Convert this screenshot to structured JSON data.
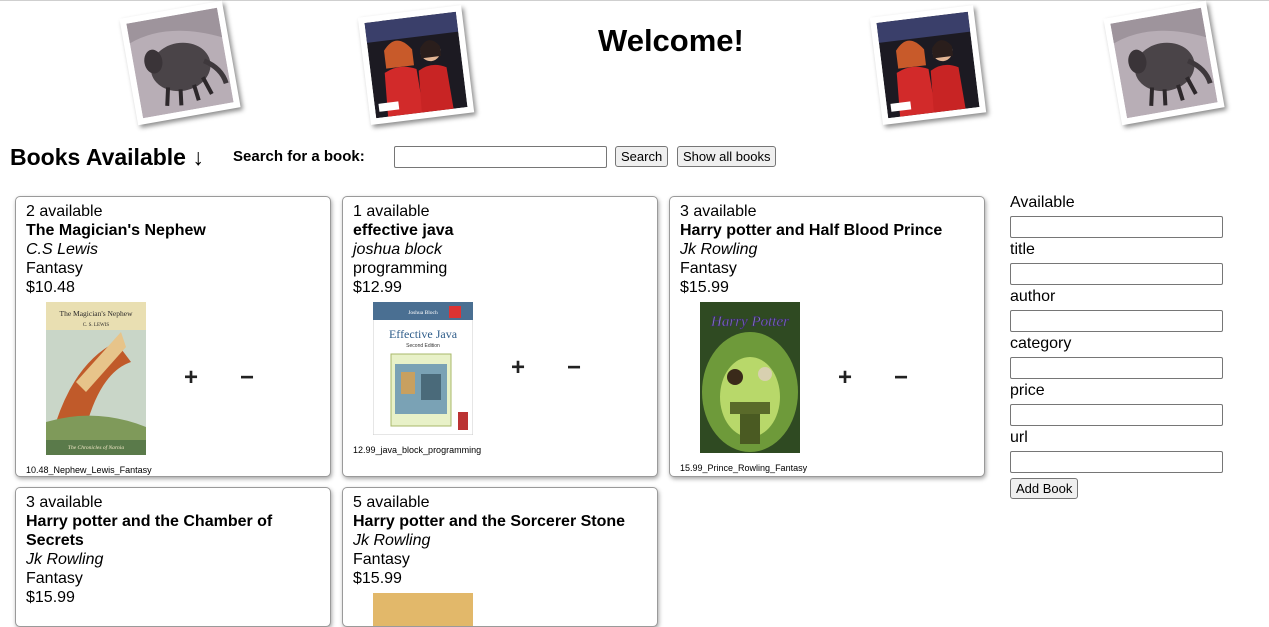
{
  "header": {
    "welcome": "Welcome!",
    "images": [
      "armadillo-photo",
      "two-women-tv-photo",
      "two-women-tv-photo",
      "armadillo-photo"
    ]
  },
  "toolbar": {
    "books_title": "Books Available ↓",
    "search_label": "Search for a book:",
    "search_value": "",
    "search_button": "Search",
    "show_all_button": "Show all books"
  },
  "books": [
    {
      "available": "2 available",
      "title": "The Magician's Nephew",
      "author": "C.S Lewis",
      "category": "Fantasy",
      "price": "$10.48",
      "caption": "10.48_Nephew_Lewis_Fantasy",
      "cover_text": [
        "The Magician's Nephew",
        "C. S. LEWIS",
        "The Chronicles of Narnia"
      ],
      "plus": "+",
      "minus": "−"
    },
    {
      "available": "1 available",
      "title": "effective java",
      "author": "joshua block",
      "category": "programming",
      "price": "$12.99",
      "caption": "12.99_java_block_programming",
      "cover_text": [
        "Joshua Bloch",
        "Effective Java",
        "Second Edition"
      ],
      "plus": "+",
      "minus": "−"
    },
    {
      "available": "3 available",
      "title": "Harry potter and Half Blood Prince",
      "author": "Jk Rowling",
      "category": "Fantasy",
      "price": "$15.99",
      "caption": "15.99_Prince_Rowling_Fantasy",
      "cover_text": [
        "Harry Potter"
      ],
      "plus": "+",
      "minus": "−"
    },
    {
      "available": "3 available",
      "title": "Harry potter and the Chamber of Secrets",
      "author": "Jk Rowling",
      "category": "Fantasy",
      "price": "$15.99"
    },
    {
      "available": "5 available",
      "title": "Harry potter and the Sorcerer Stone",
      "author": "Jk Rowling",
      "category": "Fantasy",
      "price": "$15.99"
    }
  ],
  "form": {
    "fields": [
      "Available",
      "title",
      "author",
      "category",
      "price",
      "url"
    ],
    "add_button": "Add Book"
  }
}
